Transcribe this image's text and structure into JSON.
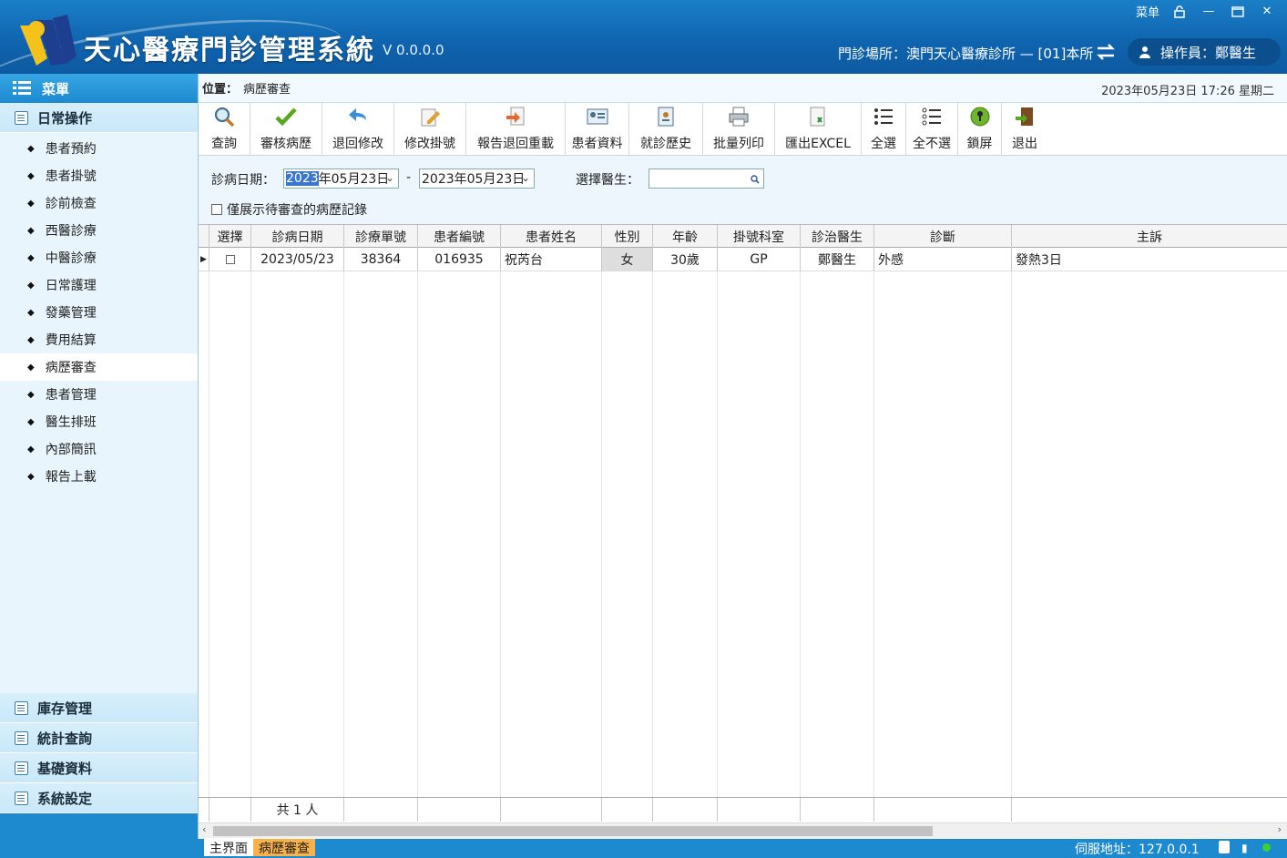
{
  "app": {
    "title": "天心醫療門診管理系統",
    "version": "V 0.0.0.0",
    "menu_label": "菜单",
    "clinic": "門診場所：澳門天心醫療診所 — [01]本所",
    "operator": "操作員：鄭醫生"
  },
  "sidebar": {
    "header": "菜單",
    "group": "日常操作",
    "items": [
      "患者預約",
      "患者掛號",
      "診前檢查",
      "西醫診療",
      "中醫診療",
      "日常護理",
      "發藥管理",
      "費用結算",
      "病歷審查",
      "患者管理",
      "醫生排班",
      "內部簡訊",
      "報告上載"
    ],
    "bottom_groups": [
      "庫存管理",
      "統計查詢",
      "基礎資料",
      "系統設定"
    ]
  },
  "breadcrumb": {
    "label": "位置：",
    "value": "病歷審查",
    "datetime": "2023年05月23日 17:26  星期二"
  },
  "toolbar": [
    "查詢",
    "審核病歷",
    "退回修改",
    "修改掛號",
    "報告退回重載",
    "患者資料",
    "就診歷史",
    "批量列印",
    "匯出EXCEL",
    "全選",
    "全不選",
    "鎖屏",
    "退出"
  ],
  "filter": {
    "date_label": "診病日期：",
    "date_from_sel": "2023",
    "date_from_rest": "年05月23日",
    "date_to": "2023年05月23日",
    "doctor_label": "選擇醫生：",
    "pending_only": "僅展示待審查的病歷記錄"
  },
  "table": {
    "columns": [
      "選擇",
      "診病日期",
      "診療單號",
      "患者編號",
      "患者姓名",
      "性別",
      "年齡",
      "掛號科室",
      "診治醫生",
      "診斷",
      "主訴"
    ],
    "rows": [
      {
        "date": "2023/05/23",
        "no": "38364",
        "pid": "016935",
        "name": "祝芮台",
        "sex": "女",
        "age": "30歲",
        "dept": "GP",
        "doctor": "鄭醫生",
        "diag": "外感",
        "complaint": "發熱3日"
      }
    ],
    "footer_count": "共 1 人"
  },
  "status": {
    "tab_main": "主界面",
    "tab_review": "病歷審查",
    "server": "伺服地址：127.0.0.1"
  },
  "colors": {
    "title_bar": "#0f63ad",
    "sidebar": "#e8f5fc",
    "status_bar": "#1d8ad0",
    "active_tab": "#f9b24a"
  }
}
